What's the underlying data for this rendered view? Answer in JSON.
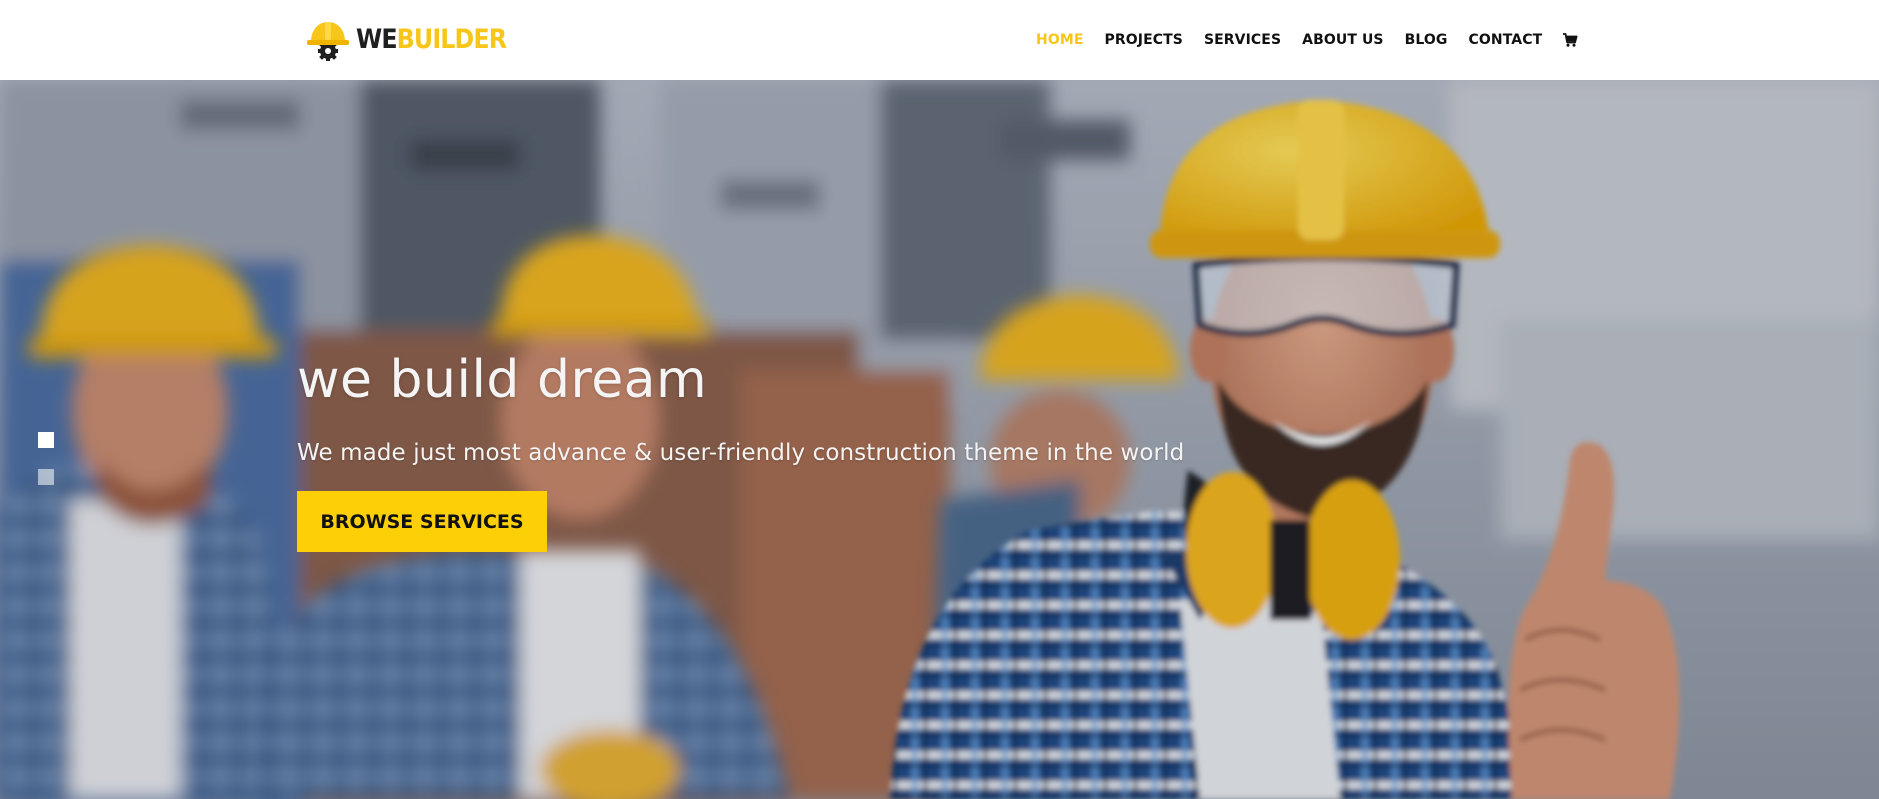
{
  "brand": {
    "part1": "WE",
    "part2": "BUILDER",
    "primary_color": "#f7c619",
    "dark_color": "#1f1f1f",
    "icon": "hard-hat-gear-icon"
  },
  "nav": {
    "items": [
      {
        "label": "HOME",
        "active": true
      },
      {
        "label": "PROJECTS",
        "active": false
      },
      {
        "label": "SERVICES",
        "active": false
      },
      {
        "label": "ABOUT US",
        "active": false
      },
      {
        "label": "BLOG",
        "active": false
      },
      {
        "label": "CONTACT",
        "active": false
      }
    ],
    "cart_icon": "cart-icon",
    "active_color": "#f7c619"
  },
  "hero": {
    "title": "we build dream",
    "subtitle": "We made just most advance & user-friendly construction theme in the world",
    "button_label": "BROWSE SERVICES",
    "button_color": "#fccf07",
    "slides": [
      {
        "active": true
      },
      {
        "active": false
      }
    ]
  }
}
